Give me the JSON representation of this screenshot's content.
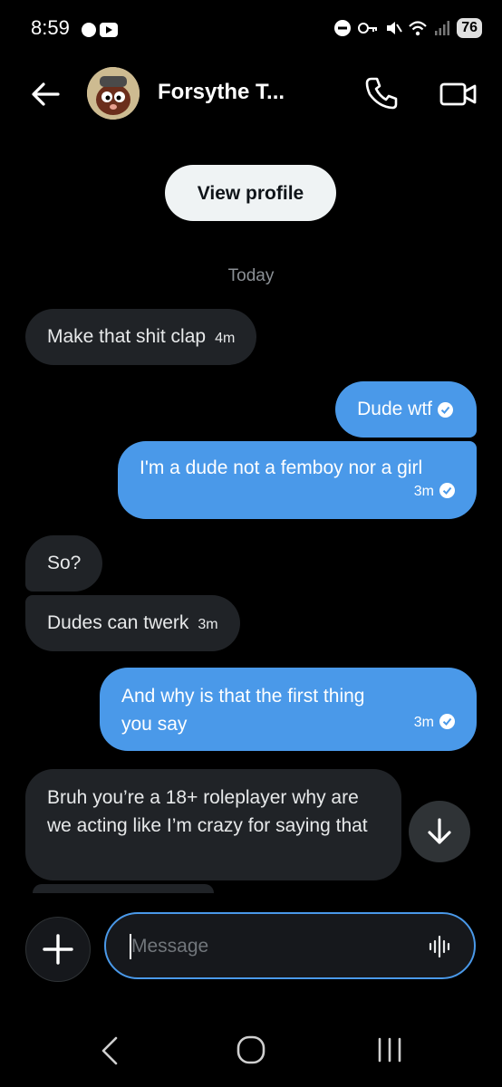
{
  "status_bar": {
    "time": "8:59",
    "battery": "76"
  },
  "header": {
    "contact_name": "Forsythe T..."
  },
  "view_profile_label": "View profile",
  "date_separator": "Today",
  "messages": [
    {
      "direction": "in",
      "text": "Make that shit clap",
      "time": "4m"
    },
    {
      "direction": "out",
      "text": "Dude wtf",
      "time": "",
      "read": true
    },
    {
      "direction": "out",
      "text": "I'm a dude not a femboy nor a girl",
      "time": "3m",
      "read": true
    },
    {
      "direction": "in",
      "text": "So?",
      "time": ""
    },
    {
      "direction": "in",
      "text": "Dudes can twerk",
      "time": "3m"
    },
    {
      "direction": "out",
      "text": "And why is that the first thing you say",
      "time": "3m",
      "read": true
    },
    {
      "direction": "in",
      "text": "Bruh you’re a 18+ roleplayer why are we acting like I’m crazy for saying that",
      "time": ""
    }
  ],
  "composer": {
    "placeholder": "Message"
  },
  "colors": {
    "background": "#000000",
    "outgoing": "#4a99e9",
    "incoming": "#202327",
    "accent": "#4a99e9"
  },
  "icons": [
    "back-arrow-icon",
    "phone-icon",
    "video-camera-icon",
    "plus-icon",
    "voice-waveform-icon",
    "arrow-down-icon",
    "read-check-icon"
  ]
}
